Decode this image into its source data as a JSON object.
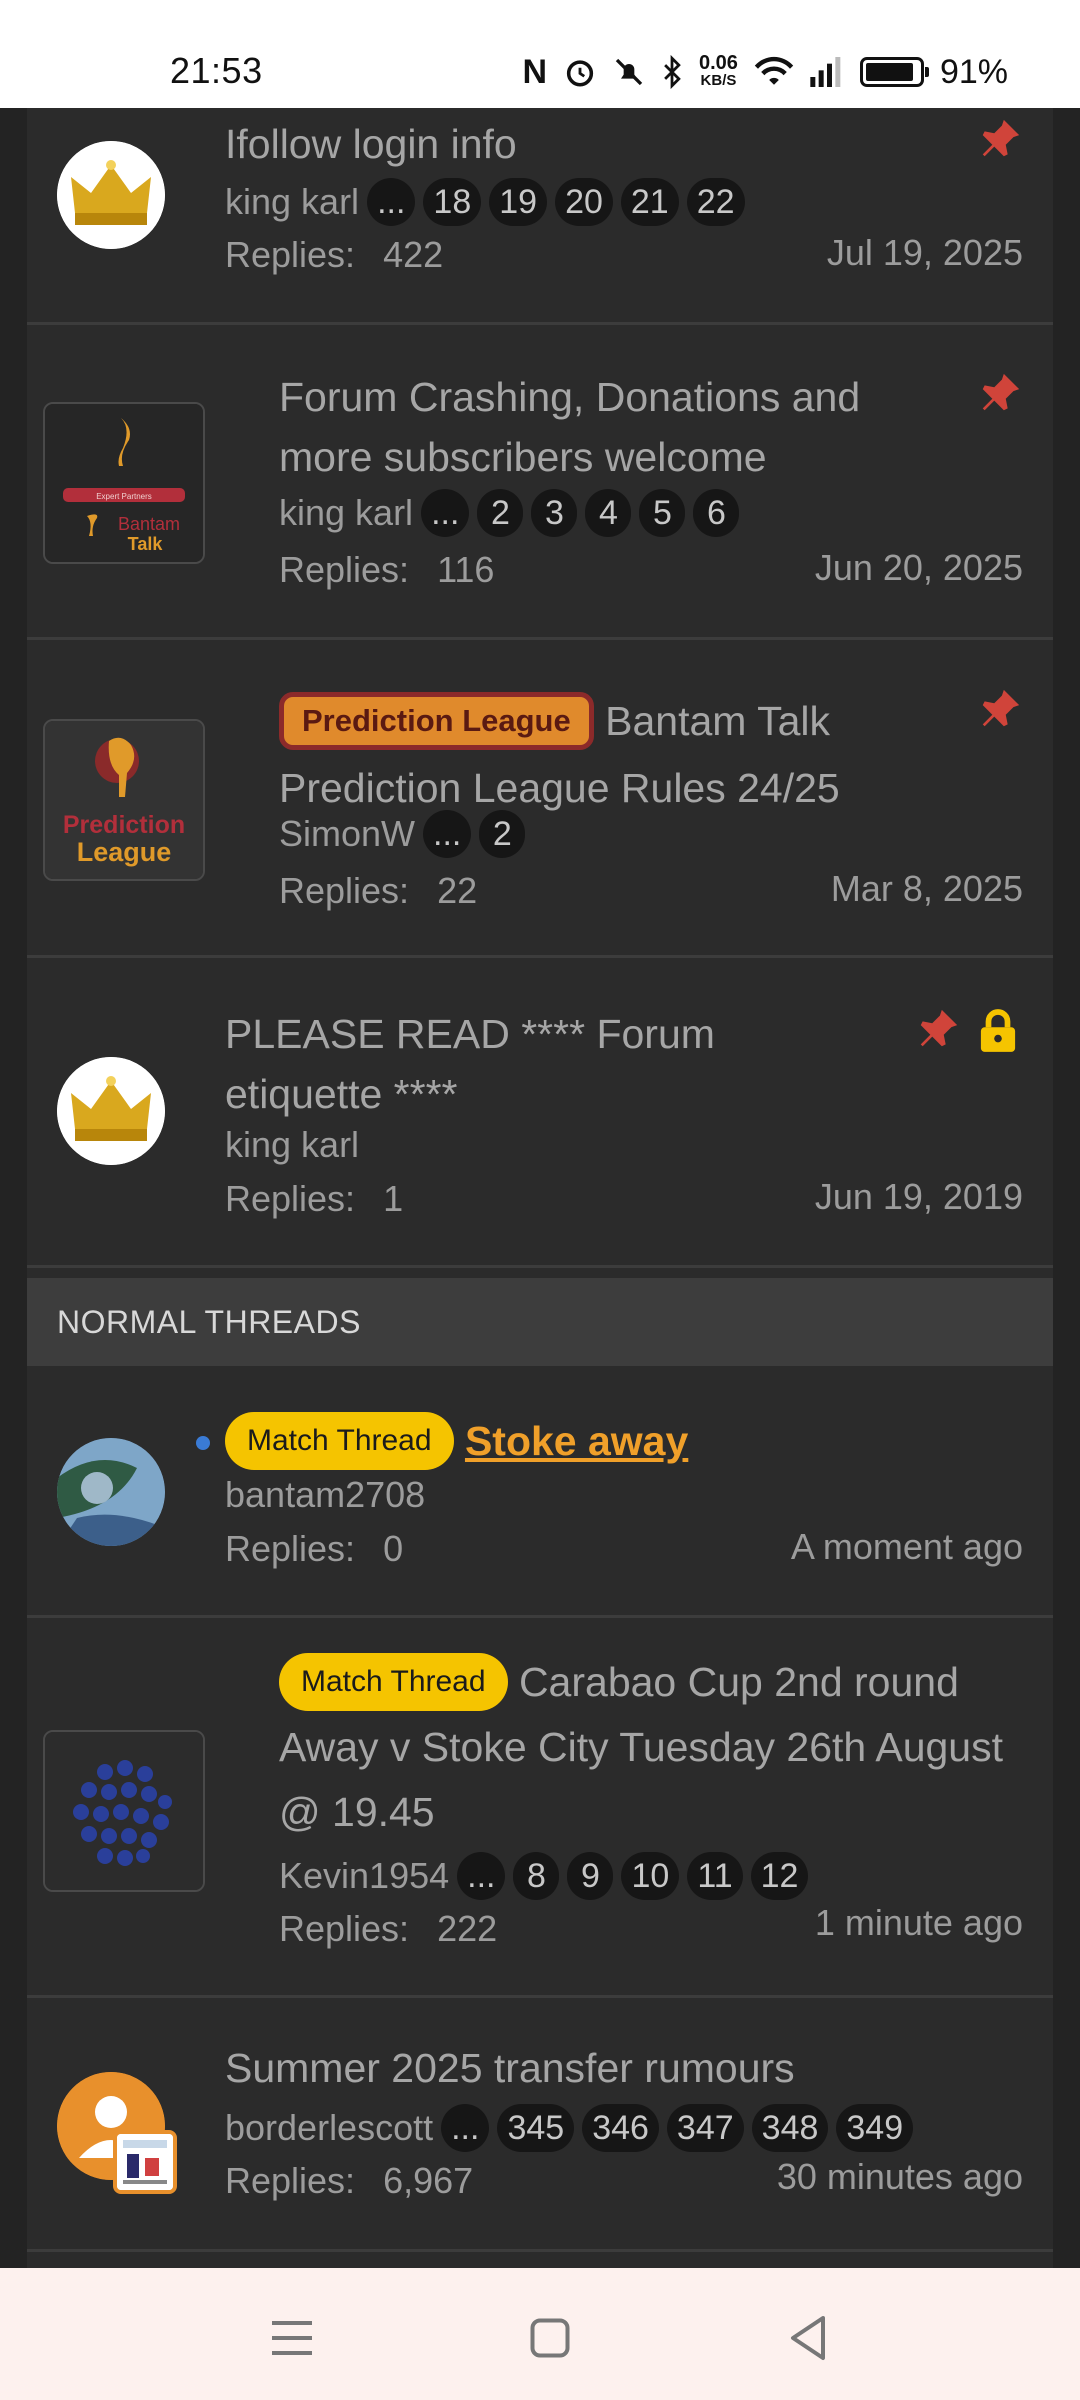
{
  "status_bar": {
    "time": "21:53",
    "net_speed_value": "0.06",
    "net_speed_unit": "KB/S",
    "battery": "91%",
    "battery_level": 0.91
  },
  "pinned_threads": [
    {
      "title": "Ifollow login info",
      "author": "king karl",
      "pages": [
        "...",
        "18",
        "19",
        "20",
        "21",
        "22"
      ],
      "replies_label": "Replies:",
      "replies": "422",
      "date": "Jul 19, 2025"
    },
    {
      "title": "Forum Crashing, Donations and more subscribers welcome",
      "author": "king karl",
      "pages": [
        "...",
        "2",
        "3",
        "4",
        "5",
        "6"
      ],
      "replies_label": "Replies:",
      "replies": "116",
      "date": "Jun 20, 2025",
      "avatar_text_1": "Expert Partners",
      "avatar_text_2": "Bantam",
      "avatar_text_3": "Talk"
    },
    {
      "prefix": "Prediction League",
      "title": "Bantam Talk Prediction League Rules 24/25",
      "author": "SimonW",
      "pages": [
        "...",
        "2"
      ],
      "replies_label": "Replies:",
      "replies": "22",
      "date": "Mar 8, 2025",
      "avatar_text_1": "Prediction",
      "avatar_text_2": "League"
    },
    {
      "title": "PLEASE READ **** Forum etiquette ****",
      "author": "king karl",
      "replies_label": "Replies:",
      "replies": "1",
      "date": "Jun 19, 2019"
    }
  ],
  "section": {
    "normal_threads": "NORMAL THREADS"
  },
  "normal_threads": [
    {
      "prefix": "Match Thread",
      "title": "Stoke away",
      "author": "bantam2708",
      "replies_label": "Replies:",
      "replies": "0",
      "date": "A moment ago"
    },
    {
      "prefix": "Match Thread",
      "title": "Carabao Cup 2nd round Away v Stoke City Tuesday 26th August @ 19.45",
      "author": "Kevin1954",
      "pages": [
        "...",
        "8",
        "9",
        "10",
        "11",
        "12"
      ],
      "replies_label": "Replies:",
      "replies": "222",
      "date": "1 minute ago"
    },
    {
      "title": "Summer 2025 transfer rumours",
      "author": "borderlescott",
      "pages": [
        "...",
        "345",
        "346",
        "347",
        "348",
        "349"
      ],
      "replies_label": "Replies:",
      "replies": "6,967",
      "date": "30 minutes ago"
    }
  ],
  "colors": {
    "accent": "#f0a02a",
    "pin": "#d0443a",
    "lock": "#f5c400",
    "tag_yellow": "#f5c400",
    "tag_orange": "#e08a2c",
    "unread_dot": "#3a7bd5"
  },
  "icons": {
    "pin": "pin-icon",
    "lock": "lock-icon",
    "menu": "menu-icon",
    "home": "home-icon",
    "back": "back-icon"
  }
}
